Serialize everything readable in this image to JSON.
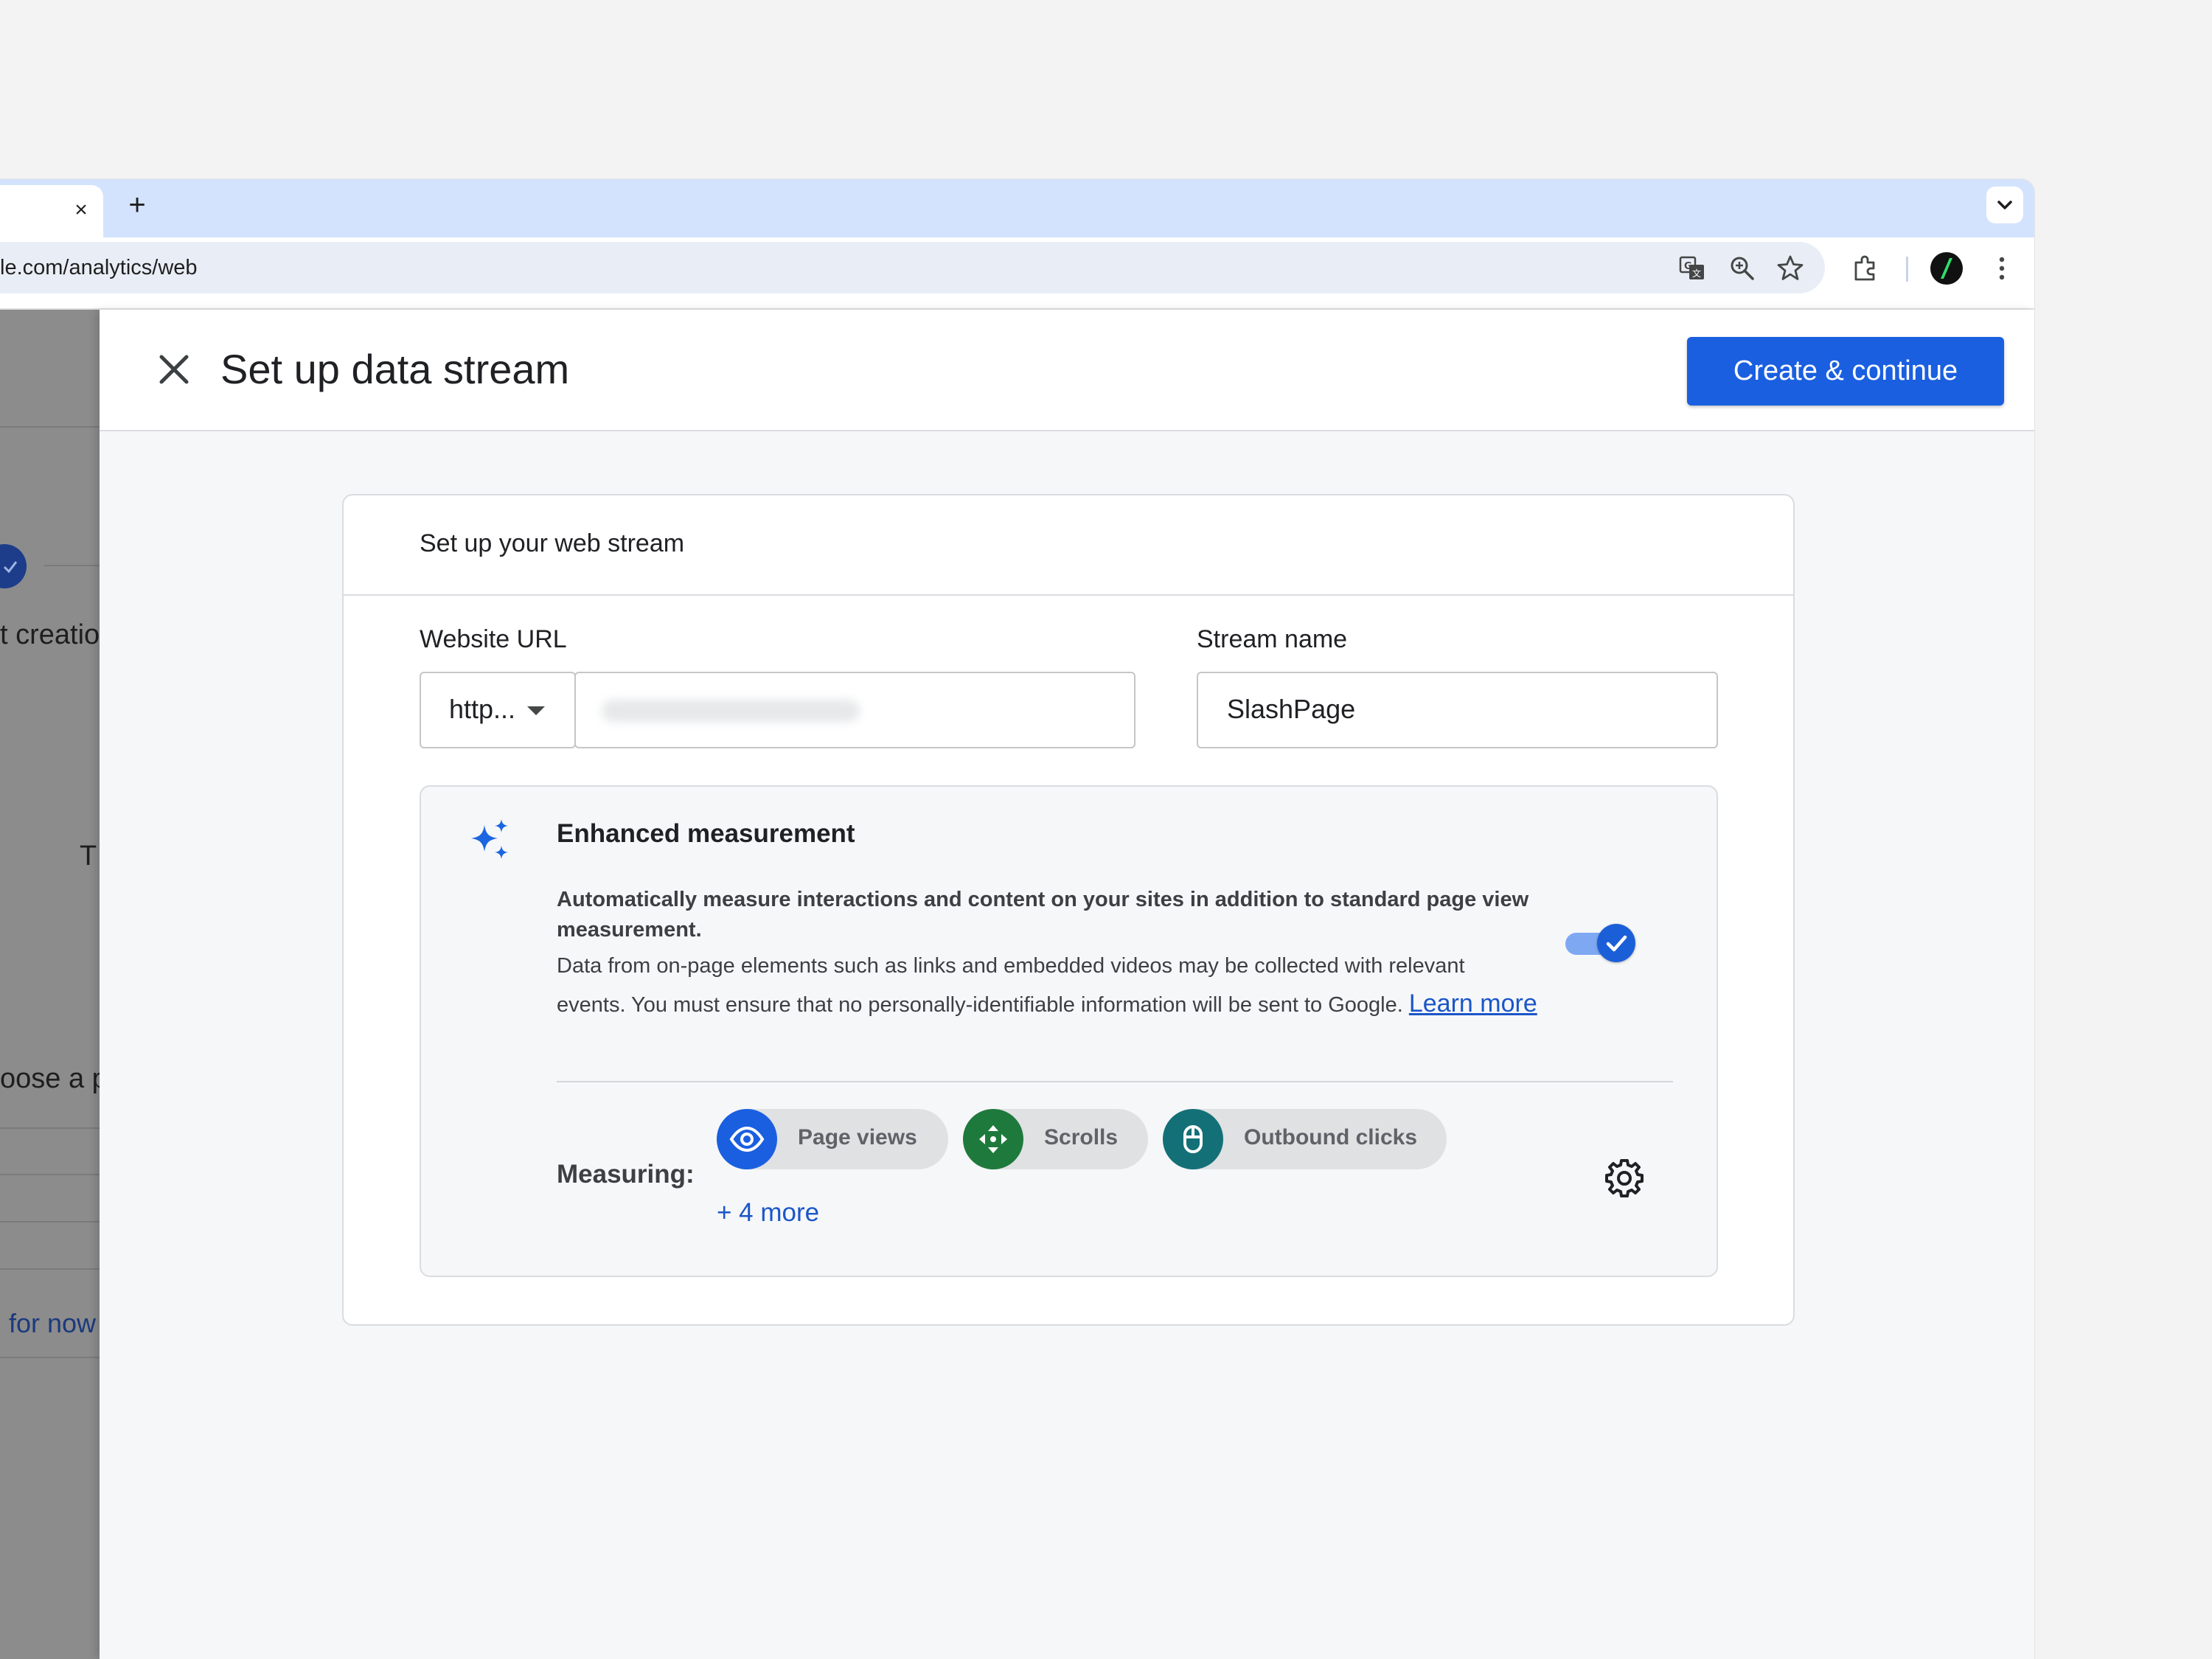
{
  "browser": {
    "tab_close": "×",
    "new_tab": "+",
    "address": "le.com/analytics/web"
  },
  "background_page": {
    "creation_text": "t creation",
    "t_fragment": "T",
    "choose_fragment": "oose a p",
    "for_now_link": "l for now"
  },
  "panel": {
    "title": "Set up data stream",
    "create_button": "Create & continue"
  },
  "card": {
    "title": "Set up your web stream",
    "website_url_label": "Website URL",
    "protocol_value": "http...",
    "url_value": "",
    "stream_name_label": "Stream name",
    "stream_name_value": "SlashPage"
  },
  "enhanced_measurement": {
    "title": "Enhanced measurement",
    "bold_text": "Automatically measure interactions and content on your sites in addition to standard page view measurement.",
    "description": "Data from on-page elements such as links and embedded videos may be collected with relevant events. You must ensure that no personally-identifiable information will be sent to Google.",
    "learn_more": "Learn more",
    "enabled": true,
    "measuring_label": "Measuring:",
    "chips": [
      {
        "label": "Page views",
        "icon": "eye-icon",
        "color": "#1a5fe0"
      },
      {
        "label": "Scrolls",
        "icon": "scroll-icon",
        "color": "#1e7a3c"
      },
      {
        "label": "Outbound clicks",
        "icon": "mouse-icon",
        "color": "#137077"
      }
    ],
    "more_link": "+ 4 more"
  },
  "colors": {
    "primary": "#1a5fe0",
    "tab_strip": "#d3e3fd",
    "link": "#1a56c8"
  }
}
